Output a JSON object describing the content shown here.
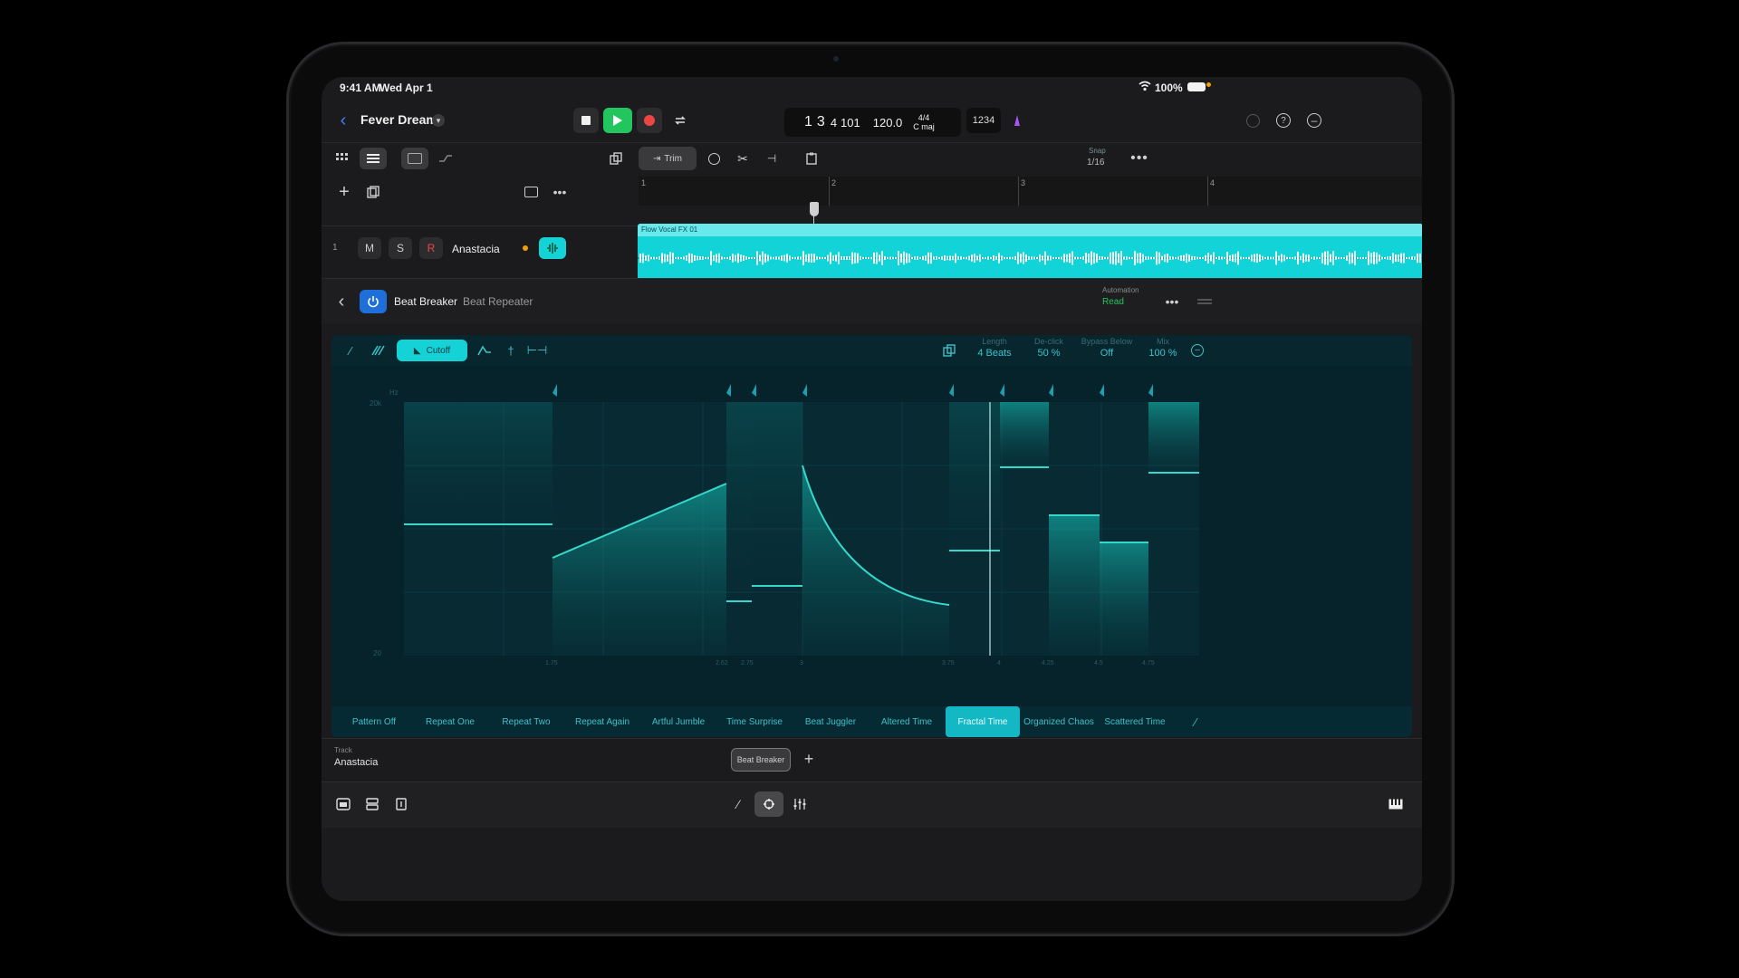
{
  "status": {
    "time": "9:41 AM",
    "date": "Wed Apr 1",
    "battery": "100%"
  },
  "project": {
    "title": "Fever Dream"
  },
  "transport": {
    "position_bar": "1",
    "position_beat": "3",
    "position_sub": "4",
    "position_tick": "101",
    "tempo": "120.0",
    "signature": "4/4",
    "key": "C maj",
    "count_in": "1234"
  },
  "edit_toolbar": {
    "trim_label": "Trim",
    "snap_label": "Snap",
    "snap_value": "1/16"
  },
  "ruler": {
    "marks": [
      "1",
      "2",
      "3",
      "4"
    ]
  },
  "track": {
    "number": "1",
    "mute": "M",
    "solo": "S",
    "record": "R",
    "name": "Anastacia"
  },
  "region": {
    "name": "Flow Vocal FX 01"
  },
  "plugin": {
    "name": "Beat Breaker",
    "preset": "Beat Repeater",
    "automation_label": "Automation",
    "automation_value": "Read",
    "mode_label": "Cutoff",
    "params": [
      {
        "label": "Length",
        "value": "4 Beats"
      },
      {
        "label": "De-click",
        "value": "50 %"
      },
      {
        "label": "Bypass Below",
        "value": "Off"
      },
      {
        "label": "Mix",
        "value": "100 %"
      }
    ],
    "y_axis": {
      "unit": "Hz",
      "top": "20k",
      "bottom": "20"
    },
    "x_ticks": [
      "1.75",
      "2.62",
      "2.75",
      "3",
      "3.75",
      "4",
      "4.25",
      "4.5",
      "4.75"
    ],
    "presets": [
      "Pattern Off",
      "Repeat One",
      "Repeat Two",
      "Repeat Again",
      "Artful Jumble",
      "Time Surprise",
      "Beat Juggler",
      "Altered Time",
      "Fractal Time",
      "Organized Chaos",
      "Scattered Time"
    ],
    "active_preset": "Fractal Time"
  },
  "bottom": {
    "track_label": "Track",
    "track_name": "Anastacia",
    "plugin_tab": "Beat Breaker",
    "add": "+"
  },
  "colors": {
    "accent": "#14d2d6",
    "play": "#22c55e",
    "record": "#ef4444",
    "plugin_bg": "#06222a"
  }
}
